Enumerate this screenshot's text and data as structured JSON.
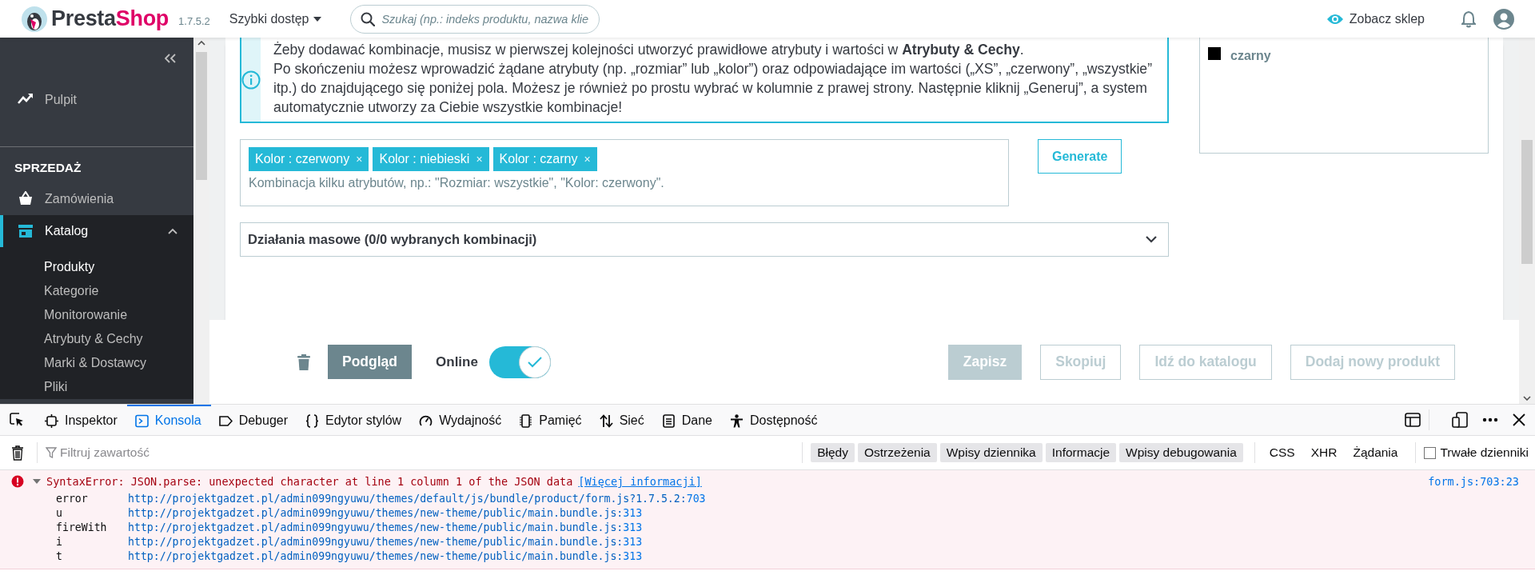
{
  "header": {
    "logo_text": [
      "Presta",
      "Shop"
    ],
    "version": "1.7.5.2",
    "quick_access": "Szybki dostęp",
    "search": {
      "placeholder": "Szukaj (np.: indeks produktu, nazwa klie"
    },
    "view_shop": "Zobacz sklep"
  },
  "sidebar": {
    "items": [
      {
        "kind": "link",
        "label": "Pulpit",
        "selected": false
      },
      {
        "kind": "section",
        "label": "SPRZEDAŻ"
      },
      {
        "kind": "link",
        "label": "Zamówienia",
        "selected": false
      },
      {
        "kind": "link",
        "label": "Katalog",
        "selected": true,
        "expanded": true,
        "children": [
          {
            "label": "Produkty",
            "selected": true
          },
          {
            "label": "Kategorie",
            "selected": false
          },
          {
            "label": "Monitorowanie",
            "selected": false
          },
          {
            "label": "Atrybuty & Cechy",
            "selected": false
          },
          {
            "label": "Marki & Dostawcy",
            "selected": false
          },
          {
            "label": "Pliki",
            "selected": false
          }
        ]
      }
    ]
  },
  "info": {
    "paragraphs": [
      "Żeby dodawać kombinacje, musisz w pierwszej kolejności utworzyć prawidłowe atrybuty i wartości w **Atrybuty & Cechy**.",
      "Po skończeniu możesz wprowadzić żądane atrybuty (np. „rozmiar” lub „kolor”) oraz odpowiadające im wartości („XS”, „czerwony”, „wszystkie” itp.) do znajdującego się poniżej pola. Możesz je również po prostu wybrać w kolumnie z prawej strony. Następnie kliknij „Generuj”, a system automatycznie utworzy za Ciebie wszystkie kombinacje!"
    ]
  },
  "attribute_panel": {
    "values": [
      {
        "label": "czarny",
        "color": "#000000"
      }
    ]
  },
  "combinations": {
    "tags": [
      {
        "label": "Kolor : czerwony",
        "remove": "×"
      },
      {
        "label": "Kolor : niebieski",
        "remove": "×"
      },
      {
        "label": "Kolor : czarny",
        "remove": "×"
      }
    ],
    "placeholder": "Kombinacja kilku atrybutów, np.: \"Rozmiar: wszystkie\", \"Kolor: czerwony\".",
    "generate": "Generate"
  },
  "bulk_actions": {
    "label": "Działania masowe (0/0 wybranych kombinacji)",
    "expanded": false
  },
  "footer": {
    "preview": "Podgląd",
    "online": {
      "label": "Online",
      "on": true
    },
    "buttons": [
      {
        "label": "Zapisz",
        "kind": "primary",
        "disabled": true
      },
      {
        "label": "Skopiuj",
        "kind": "outline",
        "disabled": true
      },
      {
        "label": "Idź do katalogu",
        "kind": "outline",
        "disabled": true
      },
      {
        "label": "Dodaj nowy produkt",
        "kind": "outline",
        "disabled": true
      }
    ]
  },
  "devtools": {
    "tabs": [
      {
        "label": "Inspektor",
        "selected": false
      },
      {
        "label": "Konsola",
        "selected": true
      },
      {
        "label": "Debuger",
        "selected": false
      },
      {
        "label": "Edytor stylów",
        "selected": false
      },
      {
        "label": "Wydajność",
        "selected": false
      },
      {
        "label": "Pamięć",
        "selected": false
      },
      {
        "label": "Sieć",
        "selected": false
      },
      {
        "label": "Dane",
        "selected": false
      },
      {
        "label": "Dostępność",
        "selected": false
      }
    ],
    "filter": {
      "placeholder": "Filtruj zawartość"
    },
    "levels": [
      {
        "label": "Błędy",
        "selected": true
      },
      {
        "label": "Ostrzeżenia",
        "selected": true
      },
      {
        "label": "Wpisy dziennika",
        "selected": true
      },
      {
        "label": "Informacje",
        "selected": true
      },
      {
        "label": "Wpisy debugowania",
        "selected": true
      }
    ],
    "types": [
      {
        "label": "CSS",
        "selected": false
      },
      {
        "label": "XHR",
        "selected": false
      },
      {
        "label": "Żądania",
        "selected": false
      }
    ],
    "persist": {
      "label": "Trwałe dzienniki",
      "checked": false
    },
    "messages": [
      {
        "kind": "error",
        "expanded": true,
        "text": "SyntaxError: JSON.parse: unexpected character at line 1 column 1 of the JSON data",
        "link": "[Więcej informacji]",
        "location": "form.js:703:23",
        "frames": [
          {
            "function": "error",
            "url": "http://projektgadzet.pl/admin099ngyuwu/themes/default/js/bundle/product/form.js?1.7.5.2:",
            "line": "703"
          },
          {
            "function": "u",
            "url": "http://projektgadzet.pl/admin099ngyuwu/themes/new-theme/public/main.bundle.js:",
            "line": "313"
          },
          {
            "function": "fireWith",
            "url": "http://projektgadzet.pl/admin099ngyuwu/themes/new-theme/public/main.bundle.js:",
            "line": "313"
          },
          {
            "function": "i",
            "url": "http://projektgadzet.pl/admin099ngyuwu/themes/new-theme/public/main.bundle.js:",
            "line": "313"
          },
          {
            "function": "t",
            "url": "http://projektgadzet.pl/admin099ngyuwu/themes/new-theme/public/main.bundle.js:",
            "line": "313"
          }
        ]
      }
    ]
  }
}
